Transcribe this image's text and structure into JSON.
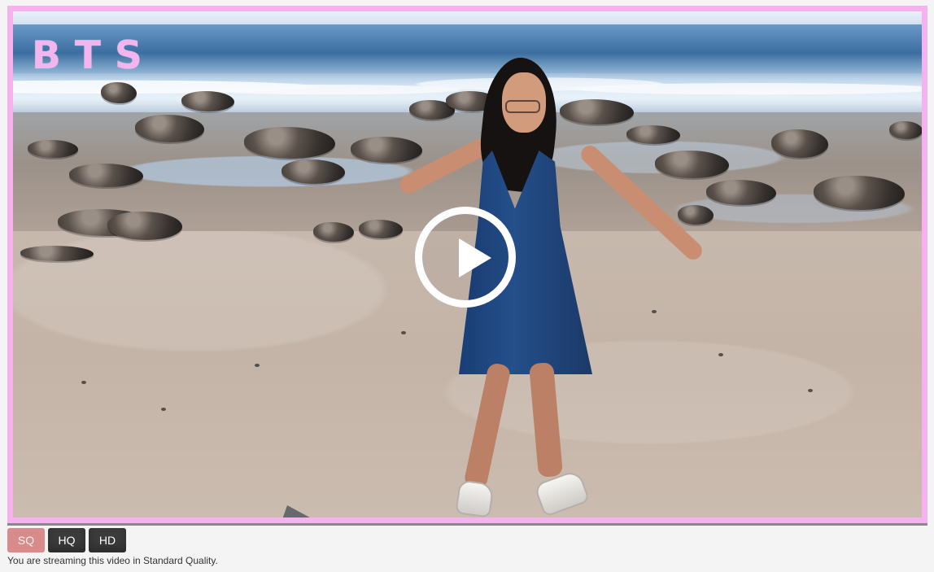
{
  "video": {
    "overlay_title": "BTS",
    "play_icon": "play-icon"
  },
  "quality": {
    "buttons": [
      {
        "label": "SQ",
        "state": "selected"
      },
      {
        "label": "HQ",
        "state": "available"
      },
      {
        "label": "HD",
        "state": "available"
      }
    ],
    "status": "You are streaming this video in Standard Quality."
  },
  "colors": {
    "frame_pink": "#f6b2ee",
    "selected_quality": "#d98a8a",
    "dark_button": "#3b3b3b"
  }
}
